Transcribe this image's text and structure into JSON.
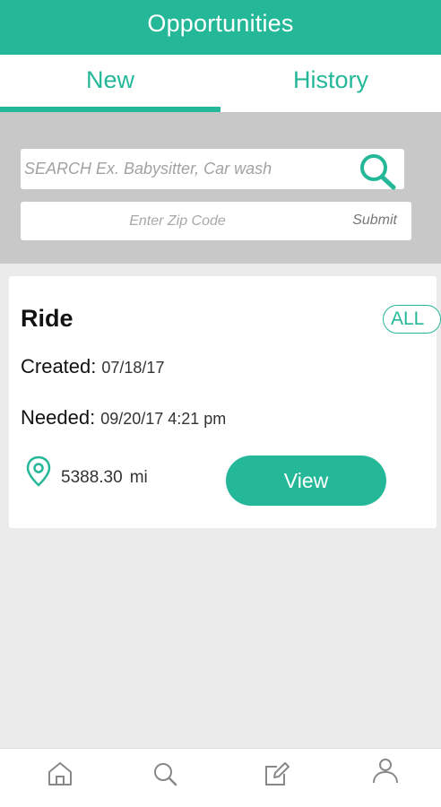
{
  "header": {
    "title": "Opportunities"
  },
  "tabs": [
    {
      "label": "New",
      "active": true
    },
    {
      "label": "History",
      "active": false
    }
  ],
  "search": {
    "placeholder": "SEARCH Ex. Babysitter, Car wash",
    "zip_placeholder": "Enter Zip Code",
    "submit_label": "Submit",
    "icon": "search-icon"
  },
  "card": {
    "title": "Ride",
    "badge": "ALL",
    "created_label": "Created:",
    "created_value": "07/18/17",
    "needed_label": "Needed:",
    "needed_value": "09/20/17 4:21 pm",
    "distance": "5388.30",
    "distance_unit": "mi",
    "view_label": "View",
    "icon": "location-pin-icon"
  },
  "bottom_nav": [
    "home-icon",
    "search-icon",
    "edit-icon",
    "profile-icon"
  ],
  "colors": {
    "accent": "#25b898",
    "search_bg": "#c8c8c8",
    "page_bg": "#ebebeb"
  }
}
